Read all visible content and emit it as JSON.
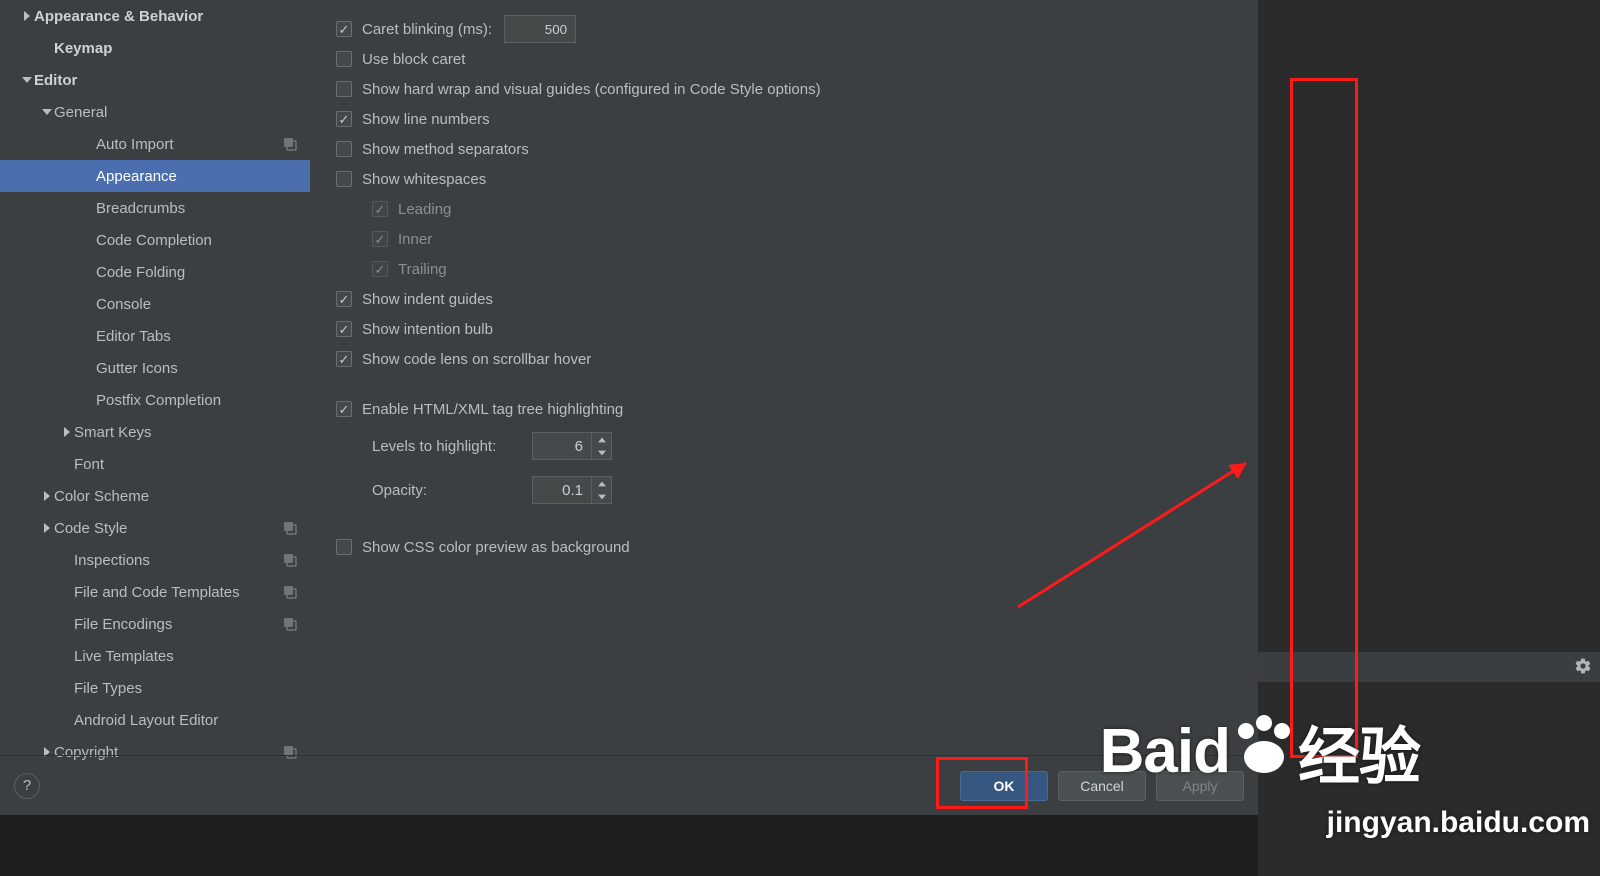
{
  "sidebar": {
    "items": [
      {
        "label": "Appearance & Behavior",
        "indent": 20,
        "bold": true,
        "arrow": "right",
        "badge": false
      },
      {
        "label": "Keymap",
        "indent": 40,
        "bold": true,
        "arrow": "",
        "badge": false
      },
      {
        "label": "Editor",
        "indent": 20,
        "bold": true,
        "arrow": "down",
        "badge": false
      },
      {
        "label": "General",
        "indent": 40,
        "bold": false,
        "arrow": "down",
        "badge": false
      },
      {
        "label": "Auto Import",
        "indent": 82,
        "bold": false,
        "arrow": "",
        "badge": true
      },
      {
        "label": "Appearance",
        "indent": 82,
        "bold": false,
        "arrow": "",
        "badge": false,
        "selected": true
      },
      {
        "label": "Breadcrumbs",
        "indent": 82,
        "bold": false,
        "arrow": "",
        "badge": false
      },
      {
        "label": "Code Completion",
        "indent": 82,
        "bold": false,
        "arrow": "",
        "badge": false
      },
      {
        "label": "Code Folding",
        "indent": 82,
        "bold": false,
        "arrow": "",
        "badge": false
      },
      {
        "label": "Console",
        "indent": 82,
        "bold": false,
        "arrow": "",
        "badge": false
      },
      {
        "label": "Editor Tabs",
        "indent": 82,
        "bold": false,
        "arrow": "",
        "badge": false
      },
      {
        "label": "Gutter Icons",
        "indent": 82,
        "bold": false,
        "arrow": "",
        "badge": false
      },
      {
        "label": "Postfix Completion",
        "indent": 82,
        "bold": false,
        "arrow": "",
        "badge": false
      },
      {
        "label": "Smart Keys",
        "indent": 60,
        "bold": false,
        "arrow": "right",
        "badge": false
      },
      {
        "label": "Font",
        "indent": 60,
        "bold": false,
        "arrow": "",
        "badge": false
      },
      {
        "label": "Color Scheme",
        "indent": 40,
        "bold": false,
        "arrow": "right",
        "badge": false
      },
      {
        "label": "Code Style",
        "indent": 40,
        "bold": false,
        "arrow": "right",
        "badge": true
      },
      {
        "label": "Inspections",
        "indent": 60,
        "bold": false,
        "arrow": "",
        "badge": true
      },
      {
        "label": "File and Code Templates",
        "indent": 60,
        "bold": false,
        "arrow": "",
        "badge": true
      },
      {
        "label": "File Encodings",
        "indent": 60,
        "bold": false,
        "arrow": "",
        "badge": true
      },
      {
        "label": "Live Templates",
        "indent": 60,
        "bold": false,
        "arrow": "",
        "badge": false
      },
      {
        "label": "File Types",
        "indent": 60,
        "bold": false,
        "arrow": "",
        "badge": false
      },
      {
        "label": "Android Layout Editor",
        "indent": 60,
        "bold": false,
        "arrow": "",
        "badge": false
      },
      {
        "label": "Copyright",
        "indent": 40,
        "bold": false,
        "arrow": "right",
        "badge": true
      }
    ]
  },
  "content": {
    "caret_blinking": "Caret blinking (ms):",
    "caret_blinking_value": "500",
    "block_caret": "Use block caret",
    "hard_wrap": "Show hard wrap and visual guides (configured in Code Style options)",
    "line_numbers": "Show line numbers",
    "method_separators": "Show method separators",
    "whitespaces": "Show whitespaces",
    "leading": "Leading",
    "inner": "Inner",
    "trailing": "Trailing",
    "indent_guides": "Show indent guides",
    "intention_bulb": "Show intention bulb",
    "code_lens": "Show code lens on scrollbar hover",
    "html_highlight": "Enable HTML/XML tag tree highlighting",
    "levels_label": "Levels to highlight:",
    "levels_value": "6",
    "opacity_label": "Opacity:",
    "opacity_value": "0.1",
    "css_preview": "Show CSS color preview as background"
  },
  "footer": {
    "ok": "OK",
    "cancel": "Cancel",
    "apply": "Apply"
  },
  "watermark": {
    "brand1": "Baid",
    "brand2": "经验",
    "url": "jingyan.baidu.com"
  }
}
